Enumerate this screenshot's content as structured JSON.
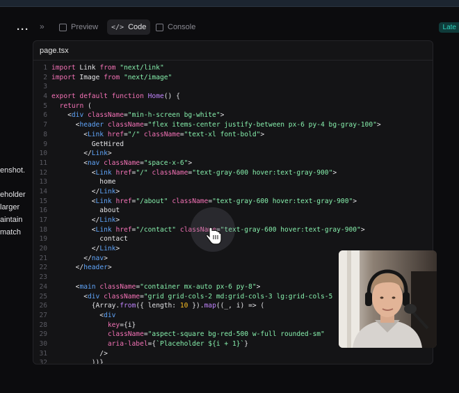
{
  "sidebar": {
    "menu_icon": "more-dots-icon",
    "chat_fragments": [
      "enshot.",
      "eholder",
      "larger",
      "aintain",
      "match"
    ]
  },
  "toolbar": {
    "collapse_icon": "double-chevron-icon",
    "tabs": [
      {
        "label": "Preview",
        "icon": "preview-icon"
      },
      {
        "label": "Code",
        "icon": "code-icon",
        "active": true
      },
      {
        "label": "Console",
        "icon": "console-icon"
      }
    ],
    "badge": "Late"
  },
  "editor": {
    "filename": "page.tsx"
  },
  "code_lines": [
    {
      "n": "1",
      "segs": [
        [
          "kw",
          "import"
        ],
        [
          "tx",
          " Link "
        ],
        [
          "kw",
          "from"
        ],
        [
          "tx",
          " "
        ],
        [
          "str",
          "\"next/link\""
        ]
      ]
    },
    {
      "n": "2",
      "segs": [
        [
          "kw",
          "import"
        ],
        [
          "tx",
          " Image "
        ],
        [
          "kw",
          "from"
        ],
        [
          "tx",
          " "
        ],
        [
          "str",
          "\"next/image\""
        ]
      ]
    },
    {
      "n": "3",
      "segs": []
    },
    {
      "n": "4",
      "segs": [
        [
          "kw",
          "export default function"
        ],
        [
          "tx",
          " "
        ],
        [
          "fn",
          "Home"
        ],
        [
          "tx",
          "() {"
        ]
      ]
    },
    {
      "n": "5",
      "segs": [
        [
          "tx",
          "  "
        ],
        [
          "kw",
          "return"
        ],
        [
          "tx",
          " ("
        ]
      ]
    },
    {
      "n": "6",
      "segs": [
        [
          "tx",
          "    <"
        ],
        [
          "tag",
          "div"
        ],
        [
          "tx",
          " "
        ],
        [
          "attr",
          "className"
        ],
        [
          "tx",
          "="
        ],
        [
          "str",
          "\"min-h-screen bg-white\""
        ],
        [
          "tx",
          ">"
        ]
      ]
    },
    {
      "n": "7",
      "segs": [
        [
          "tx",
          "      <"
        ],
        [
          "tag",
          "header"
        ],
        [
          "tx",
          " "
        ],
        [
          "attr",
          "className"
        ],
        [
          "tx",
          "="
        ],
        [
          "str",
          "\"flex items-center justify-between px-6 py-4 bg-gray-100\""
        ],
        [
          "tx",
          ">"
        ]
      ]
    },
    {
      "n": "8",
      "segs": [
        [
          "tx",
          "        <"
        ],
        [
          "tag",
          "Link"
        ],
        [
          "tx",
          " "
        ],
        [
          "attr",
          "href"
        ],
        [
          "tx",
          "="
        ],
        [
          "str",
          "\"/\""
        ],
        [
          "tx",
          " "
        ],
        [
          "attr",
          "className"
        ],
        [
          "tx",
          "="
        ],
        [
          "str",
          "\"text-xl font-bold\""
        ],
        [
          "tx",
          ">"
        ]
      ]
    },
    {
      "n": "9",
      "segs": [
        [
          "tx",
          "          GetHired"
        ]
      ]
    },
    {
      "n": "10",
      "segs": [
        [
          "tx",
          "        </"
        ],
        [
          "tag",
          "Link"
        ],
        [
          "tx",
          ">"
        ]
      ]
    },
    {
      "n": "11",
      "segs": [
        [
          "tx",
          "        <"
        ],
        [
          "tag",
          "nav"
        ],
        [
          "tx",
          " "
        ],
        [
          "attr",
          "className"
        ],
        [
          "tx",
          "="
        ],
        [
          "str",
          "\"space-x-6\""
        ],
        [
          "tx",
          ">"
        ]
      ]
    },
    {
      "n": "12",
      "segs": [
        [
          "tx",
          "          <"
        ],
        [
          "tag",
          "Link"
        ],
        [
          "tx",
          " "
        ],
        [
          "attr",
          "href"
        ],
        [
          "tx",
          "="
        ],
        [
          "str",
          "\"/\""
        ],
        [
          "tx",
          " "
        ],
        [
          "attr",
          "className"
        ],
        [
          "tx",
          "="
        ],
        [
          "str",
          "\"text-gray-600 hover:text-gray-900\""
        ],
        [
          "tx",
          ">"
        ]
      ]
    },
    {
      "n": "13",
      "segs": [
        [
          "tx",
          "            home"
        ]
      ]
    },
    {
      "n": "14",
      "segs": [
        [
          "tx",
          "          </"
        ],
        [
          "tag",
          "Link"
        ],
        [
          "tx",
          ">"
        ]
      ]
    },
    {
      "n": "15",
      "segs": [
        [
          "tx",
          "          <"
        ],
        [
          "tag",
          "Link"
        ],
        [
          "tx",
          " "
        ],
        [
          "attr",
          "href"
        ],
        [
          "tx",
          "="
        ],
        [
          "str",
          "\"/about\""
        ],
        [
          "tx",
          " "
        ],
        [
          "attr",
          "className"
        ],
        [
          "tx",
          "="
        ],
        [
          "str",
          "\"text-gray-600 hover:text-gray-900\""
        ],
        [
          "tx",
          ">"
        ]
      ]
    },
    {
      "n": "16",
      "segs": [
        [
          "tx",
          "            about"
        ]
      ]
    },
    {
      "n": "17",
      "segs": [
        [
          "tx",
          "          </"
        ],
        [
          "tag",
          "Link"
        ],
        [
          "tx",
          ">"
        ]
      ]
    },
    {
      "n": "18",
      "segs": [
        [
          "tx",
          "          <"
        ],
        [
          "tag",
          "Link"
        ],
        [
          "tx",
          " "
        ],
        [
          "attr",
          "href"
        ],
        [
          "tx",
          "="
        ],
        [
          "str",
          "\"/contact\""
        ],
        [
          "tx",
          " "
        ],
        [
          "attr",
          "className"
        ],
        [
          "tx",
          "="
        ],
        [
          "str",
          "\"text-gray-600 hover:text-gray-900\""
        ],
        [
          "tx",
          ">"
        ]
      ]
    },
    {
      "n": "19",
      "segs": [
        [
          "tx",
          "            contact"
        ]
      ]
    },
    {
      "n": "20",
      "segs": [
        [
          "tx",
          "          </"
        ],
        [
          "tag",
          "Link"
        ],
        [
          "tx",
          ">"
        ]
      ]
    },
    {
      "n": "21",
      "segs": [
        [
          "tx",
          "        </"
        ],
        [
          "tag",
          "nav"
        ],
        [
          "tx",
          ">"
        ]
      ]
    },
    {
      "n": "22",
      "segs": [
        [
          "tx",
          "      </"
        ],
        [
          "tag",
          "header"
        ],
        [
          "tx",
          ">"
        ]
      ]
    },
    {
      "n": "23",
      "segs": []
    },
    {
      "n": "24",
      "segs": [
        [
          "tx",
          "      <"
        ],
        [
          "tag",
          "main"
        ],
        [
          "tx",
          " "
        ],
        [
          "attr",
          "className"
        ],
        [
          "tx",
          "="
        ],
        [
          "str",
          "\"container mx-auto px-6 py-8\""
        ],
        [
          "tx",
          ">"
        ]
      ]
    },
    {
      "n": "25",
      "segs": [
        [
          "tx",
          "        <"
        ],
        [
          "tag",
          "div"
        ],
        [
          "tx",
          " "
        ],
        [
          "attr",
          "className"
        ],
        [
          "tx",
          "="
        ],
        [
          "str",
          "\"grid grid-cols-2 md:grid-cols-3 lg:grid-cols-5"
        ]
      ]
    },
    {
      "n": "26",
      "segs": [
        [
          "tx",
          "          {Array."
        ],
        [
          "fn",
          "from"
        ],
        [
          "tx",
          "({ length: "
        ],
        [
          "num",
          "10"
        ],
        [
          "tx",
          " })."
        ],
        [
          "fn",
          "map"
        ],
        [
          "tx",
          "((_, i) => ("
        ]
      ]
    },
    {
      "n": "27",
      "segs": [
        [
          "tx",
          "            <"
        ],
        [
          "tag",
          "div"
        ]
      ]
    },
    {
      "n": "28",
      "segs": [
        [
          "tx",
          "              "
        ],
        [
          "attr",
          "key"
        ],
        [
          "tx",
          "={i}"
        ]
      ]
    },
    {
      "n": "29",
      "segs": [
        [
          "tx",
          "              "
        ],
        [
          "attr",
          "className"
        ],
        [
          "tx",
          "="
        ],
        [
          "str",
          "\"aspect-square bg-red-500 w-full rounded-sm\""
        ]
      ]
    },
    {
      "n": "30",
      "segs": [
        [
          "tx",
          "              "
        ],
        [
          "attr",
          "aria-label"
        ],
        [
          "tx",
          "={"
        ],
        [
          "str",
          "`Placeholder ${i + 1}`"
        ],
        [
          "tx",
          "}"
        ]
      ]
    },
    {
      "n": "31",
      "segs": [
        [
          "tx",
          "            />"
        ]
      ]
    },
    {
      "n": "32",
      "segs": [
        [
          "tx",
          "          ))}"
        ]
      ]
    }
  ],
  "overlay": {
    "cursor_icon": "hand-pointer-icon",
    "webcam_label": "webcam-feed"
  }
}
